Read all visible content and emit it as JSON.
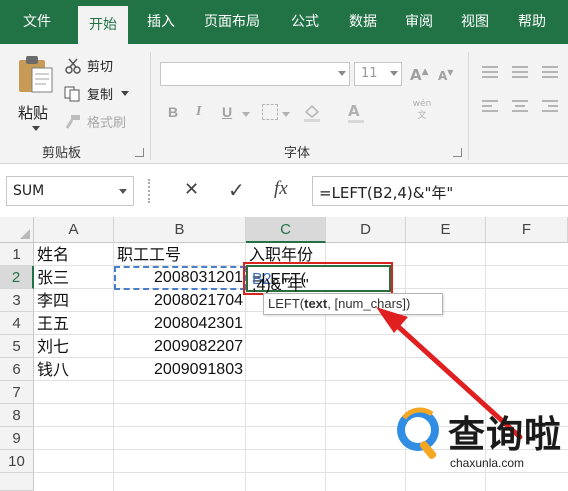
{
  "ribbon_tabs": [
    {
      "label": "文件",
      "active": false
    },
    {
      "label": "开始",
      "active": true
    },
    {
      "label": "插入",
      "active": false
    },
    {
      "label": "页面布局",
      "active": false
    },
    {
      "label": "公式",
      "active": false
    },
    {
      "label": "数据",
      "active": false
    },
    {
      "label": "审阅",
      "active": false
    },
    {
      "label": "视图",
      "active": false
    },
    {
      "label": "帮助",
      "active": false
    }
  ],
  "clipboard": {
    "paste_label": "粘贴",
    "cut_label": "剪切",
    "copy_label": "复制",
    "format_painter_label": "格式刷",
    "group_label": "剪贴板"
  },
  "font": {
    "size_value": "11",
    "bold": "B",
    "italic": "I",
    "underline": "U",
    "group_label": "字体",
    "grow_label": "A",
    "shrink_label": "A",
    "wen_label": "wén 文"
  },
  "formula_bar": {
    "name_box": "SUM",
    "cancel_symbol": "✕",
    "enter_symbol": "✓",
    "fx_symbol": "fx",
    "formula": "=LEFT(B2,4)&\"年\""
  },
  "columns": [
    "A",
    "B",
    "C",
    "D",
    "E",
    "F"
  ],
  "rows": [
    "1",
    "2",
    "3",
    "4",
    "5",
    "6",
    "7",
    "8",
    "9",
    "10"
  ],
  "sheet": {
    "headers": {
      "a": "姓名",
      "b": "职工工号",
      "c": "入职年份"
    },
    "records": [
      {
        "name": "张三",
        "id": "2008031201"
      },
      {
        "name": "李四",
        "id": "2008021704"
      },
      {
        "name": "王五",
        "id": "2008042301"
      },
      {
        "name": "刘七",
        "id": "2009082207"
      },
      {
        "name": "钱八",
        "id": "2009091803"
      }
    ],
    "edit_prefix": "=LEFT(",
    "edit_ref": "B2",
    "edit_suffix": ",4)&\"年\"",
    "tooltip_func": "LEFT(",
    "tooltip_arg1": "text",
    "tooltip_rest": ", [num_chars])"
  },
  "watermark": {
    "text": "查询啦",
    "url": "chaxunla.com"
  },
  "colors": {
    "excel_green": "#217346",
    "highlight_red": "#d9231f",
    "ref_blue": "#3f6fba"
  }
}
